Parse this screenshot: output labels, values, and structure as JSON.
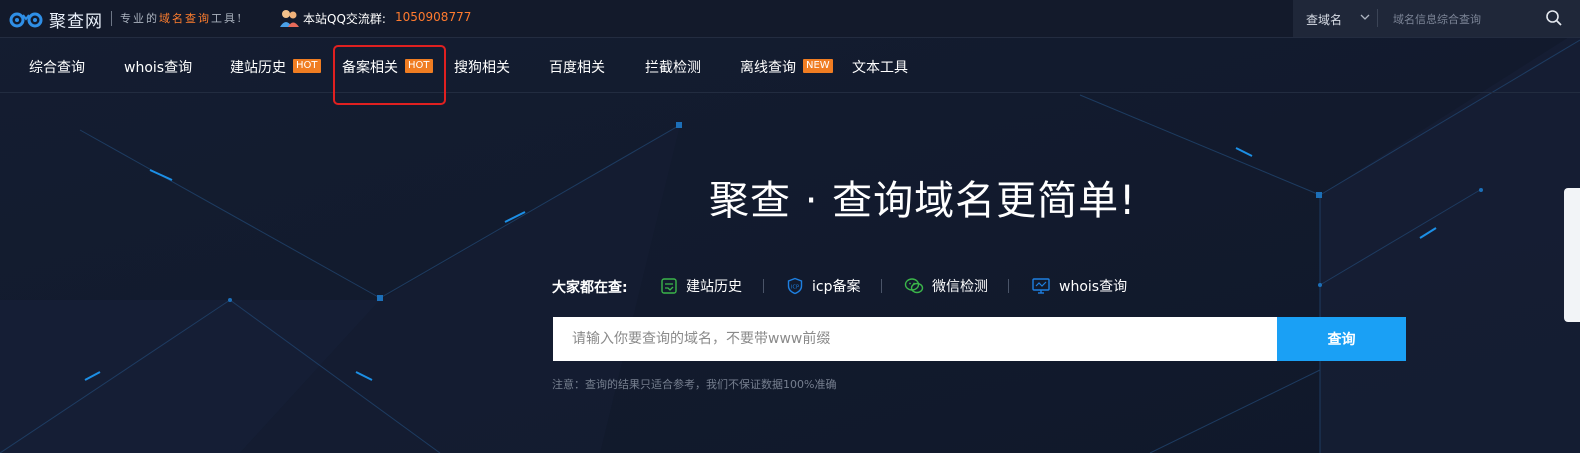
{
  "topbar": {
    "logo_text": "聚查网",
    "slogan_pre": "专业的",
    "slogan_highlight": "域名查询",
    "slogan_post": "工具!",
    "qq_label": "本站QQ交流群:",
    "qq_number": "1050908777",
    "search_type": "查域名",
    "search_placeholder": "域名信息综合查询"
  },
  "nav": {
    "items": [
      {
        "label": "综合查询"
      },
      {
        "label": "whois查询"
      },
      {
        "label": "建站历史",
        "badge": "HOT"
      },
      {
        "label": "备案相关",
        "badge": "HOT"
      },
      {
        "label": "搜狗相关"
      },
      {
        "label": "百度相关"
      },
      {
        "label": "拦截检测"
      },
      {
        "label": "离线查询",
        "badge": "NEW"
      },
      {
        "label": "文本工具"
      }
    ]
  },
  "hero": {
    "title": "聚查 · 查询域名更简单!",
    "popular_label": "大家都在查:",
    "popular": [
      {
        "label": "建站历史",
        "icon": "history-icon",
        "color": "#3bb54a"
      },
      {
        "label": "icp备案",
        "icon": "icp-shield-icon",
        "color": "#1e7fe0"
      },
      {
        "label": "微信检测",
        "icon": "wechat-icon",
        "color": "#3bb54a"
      },
      {
        "label": "whois查询",
        "icon": "whois-monitor-icon",
        "color": "#1e7fe0"
      }
    ],
    "input_placeholder": "请输入你要查询的域名，不要带www前缀",
    "button_label": "查询",
    "note": "注意：查询的结果只适合参考，我们不保证数据100%准确"
  },
  "colors": {
    "background": "#131b2e",
    "accent_orange": "#f07d22",
    "button_blue": "#1aa0f5",
    "highlight_red": "#e02020"
  }
}
